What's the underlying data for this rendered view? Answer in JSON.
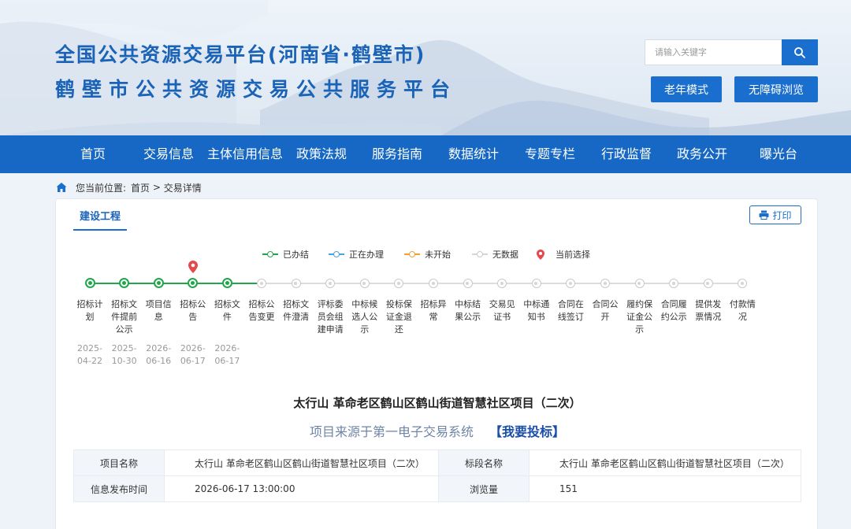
{
  "header": {
    "title_line1": "全国公共资源交易平台(河南省·鹤壁市)",
    "title_line2": "鹤壁市公共资源交易公共服务平台",
    "search_placeholder": "请输入关键字",
    "search_icon": "search-icon",
    "elder_mode": "老年模式",
    "accessible": "无障碍浏览"
  },
  "nav": {
    "items": [
      "首页",
      "交易信息",
      "主体信用信息",
      "政策法规",
      "服务指南",
      "数据统计",
      "专题专栏",
      "行政监督",
      "政务公开",
      "曝光台"
    ]
  },
  "breadcrumb": {
    "prefix": "您当前位置:",
    "home": "首页",
    "sep": " > ",
    "current": "交易详情"
  },
  "panel": {
    "tab": "建设工程",
    "print": "打印",
    "legend": {
      "done": "已办结",
      "in_progress": "正在办理",
      "not_started": "未开始",
      "no_data": "无数据",
      "current": "当前选择"
    },
    "colors": {
      "done": "#21a64b",
      "in_progress": "#4aa3df",
      "not_started": "#f0a030",
      "no_data": "#c9c9c9",
      "current": "#e5484d"
    },
    "steps": [
      {
        "label": "招标计划",
        "date_y": "2025-",
        "date_md": "04-22",
        "status": "done"
      },
      {
        "label": "招标文件提前公示",
        "date_y": "2025-",
        "date_md": "10-30",
        "status": "done"
      },
      {
        "label": "项目信息",
        "date_y": "2026-",
        "date_md": "06-16",
        "status": "done"
      },
      {
        "label": "招标公告",
        "date_y": "2026-",
        "date_md": "06-17",
        "status": "done",
        "current": true
      },
      {
        "label": "招标文件",
        "date_y": "2026-",
        "date_md": "06-17",
        "status": "done"
      },
      {
        "label": "招标公告变更",
        "status": "none"
      },
      {
        "label": "招标文件澄清",
        "status": "none"
      },
      {
        "label": "评标委员会组建申请",
        "status": "none"
      },
      {
        "label": "中标候选人公示",
        "status": "none"
      },
      {
        "label": "投标保证金退还",
        "status": "none"
      },
      {
        "label": "招标异常",
        "status": "none"
      },
      {
        "label": "中标结果公示",
        "status": "none"
      },
      {
        "label": "交易见证书",
        "status": "none"
      },
      {
        "label": "中标通知书",
        "status": "none"
      },
      {
        "label": "合同在线签订",
        "status": "none"
      },
      {
        "label": "合同公开",
        "status": "none"
      },
      {
        "label": "履约保证金公示",
        "status": "none"
      },
      {
        "label": "合同履约公示",
        "status": "none"
      },
      {
        "label": "提供发票情况",
        "status": "none"
      },
      {
        "label": "付款情况",
        "status": "none"
      }
    ],
    "project_title": "太行山 革命老区鹤山区鹤山街道智慧社区项目（二次）",
    "source_text": "项目来源于第一电子交易系统",
    "bid_link": "【我要投标】",
    "info": {
      "name_label": "项目名称",
      "name_value": "太行山 革命老区鹤山区鹤山街道智慧社区项目（二次）",
      "section_label": "标段名称",
      "section_value": "太行山 革命老区鹤山区鹤山街道智慧社区项目（二次）",
      "time_label": "信息发布时间",
      "time_value": "2026-06-17 13:00:00",
      "views_label": "浏览量",
      "views_value": "151"
    }
  }
}
